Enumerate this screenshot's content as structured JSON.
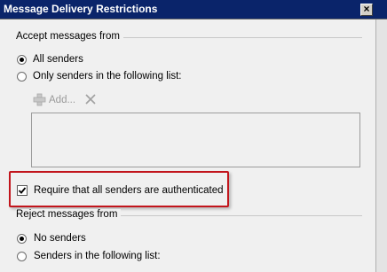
{
  "window": {
    "title": "Message Delivery Restrictions",
    "close_glyph": "×"
  },
  "accept": {
    "group_label": "Accept messages from",
    "all_senders": {
      "label": "All senders",
      "checked": true
    },
    "only_list": {
      "label": "Only senders in the following list:",
      "checked": false
    },
    "add_label": "Add...",
    "remove_icon": "x-icon"
  },
  "auth": {
    "label": "Require that all senders are authenticated",
    "checked": true
  },
  "reject": {
    "group_label": "Reject messages from",
    "no_senders": {
      "label": "No senders",
      "checked": true
    },
    "list_senders": {
      "label": "Senders in the following list:",
      "checked": false
    }
  },
  "colors": {
    "titlebar": "#0a246a",
    "highlight": "#c2151c"
  }
}
